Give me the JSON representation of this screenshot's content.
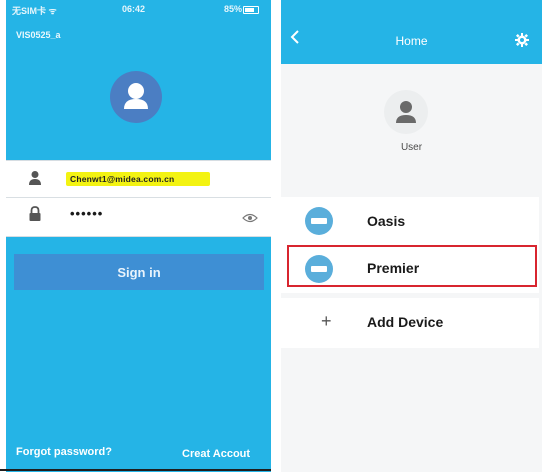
{
  "left_screen": {
    "status_bar": {
      "carrier": "无SIM卡 ᯤ",
      "time": "06:42",
      "battery": "85%"
    },
    "wifi_ssid": "VIS0525_a",
    "login": {
      "email": "Chenwt1@midea.com.cn",
      "password_masked": "••••••"
    },
    "sign_in_label": "Sign in",
    "forgot_password_label": "Forgot password?",
    "create_account_label": "Creat Accout"
  },
  "right_screen": {
    "header": {
      "title": "Home"
    },
    "user_label": "User",
    "devices": [
      {
        "label": "Oasis"
      },
      {
        "label": "Premier"
      }
    ],
    "add_device_label": "Add Device",
    "plus_symbol": "+"
  },
  "colors": {
    "header_blue": "#25b4e6",
    "button_blue": "#3e8fd4",
    "avatar_blue": "#4b7ec3",
    "device_icon": "#5aaedb",
    "highlight_red": "#d8252f",
    "email_highlight": "#f3f312"
  },
  "icons": {
    "user_avatar": "person-icon",
    "lock": "lock-icon",
    "eye": "eye-icon",
    "settings": "gear-icon",
    "back": "chevron-left-icon",
    "device": "minus-circle-icon",
    "add": "plus-icon"
  }
}
